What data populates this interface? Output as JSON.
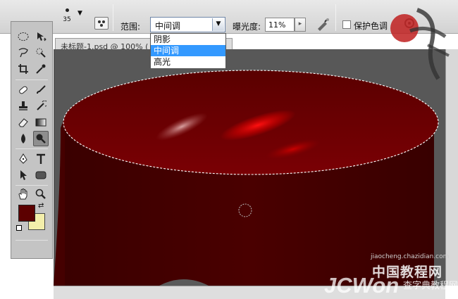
{
  "options_bar": {
    "brush_size": "35",
    "range_label": "范围:",
    "range_value": "中间调",
    "range_options": [
      "阴影",
      "中间调",
      "高光"
    ],
    "exposure_label": "曝光度:",
    "exposure_value": "11%",
    "protect_tones_label": "保护色调",
    "protect_tones_checked": false
  },
  "document": {
    "tab_title": "未标题-1.psd @ 100% (",
    "foreground_color": "#5c0000",
    "background_color": "#f3eeaa"
  },
  "tools": [
    "marquee-tool",
    "move-tool",
    "lasso-tool",
    "quick-selection-tool",
    "crop-tool",
    "eyedropper-tool",
    "spot-healing-tool",
    "brush-tool",
    "clone-stamp-tool",
    "history-brush-tool",
    "eraser-tool",
    "gradient-tool",
    "blur-tool",
    "burn-tool",
    "pen-tool",
    "type-tool",
    "path-selection-tool",
    "shape-tool",
    "hand-tool",
    "zoom-tool"
  ],
  "watermark": {
    "site_url": "jiaocheng.chazidian.com",
    "site_cn": "中国教程网",
    "site_jcw": "JCWon",
    "site_tag": "查字典教程网"
  }
}
